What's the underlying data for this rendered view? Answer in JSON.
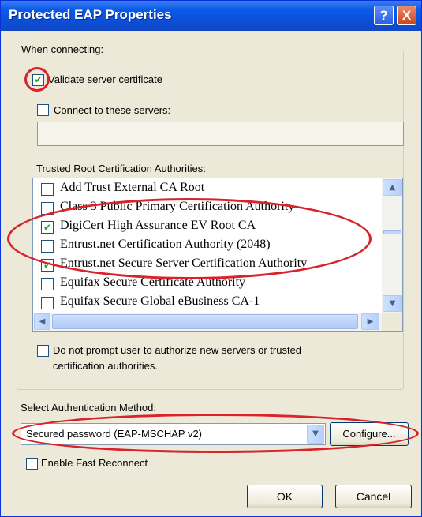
{
  "window": {
    "title": "Protected EAP Properties",
    "help_glyph": "?",
    "close_glyph": "X"
  },
  "when_connecting": {
    "label": "When connecting:",
    "validate_label": "Validate server certificate",
    "validate_checked": true,
    "connect_label": "Connect to these servers:",
    "connect_checked": false,
    "servers_value": ""
  },
  "trusted_root": {
    "label": "Trusted Root Certification Authorities:",
    "items": [
      {
        "label": "Add Trust External CA Root",
        "checked": false
      },
      {
        "label": "Class 3 Public Primary Certification Authority",
        "checked": false
      },
      {
        "label": "DigiCert High Assurance EV Root CA",
        "checked": true
      },
      {
        "label": "Entrust.net Certification Authority (2048)",
        "checked": false
      },
      {
        "label": "Entrust.net Secure Server Certification Authority",
        "checked": true
      },
      {
        "label": "Equifax Secure Certificate Authority",
        "checked": false
      },
      {
        "label": "Equifax Secure Global eBusiness CA-1",
        "checked": false
      }
    ]
  },
  "do_not_prompt": {
    "label_line1": "Do not prompt user to authorize new servers or trusted",
    "label_line2": "certification authorities.",
    "checked": false
  },
  "auth_method": {
    "label": "Select Authentication Method:",
    "selected": "Secured password (EAP-MSCHAP v2)",
    "configure_label": "Configure..."
  },
  "fast_reconnect": {
    "label": "Enable Fast Reconnect",
    "checked": false
  },
  "footer": {
    "ok_label": "OK",
    "cancel_label": "Cancel"
  },
  "colors": {
    "annotation": "#d9222a",
    "titlebar": "#0a5ae8",
    "dialog_bg": "#ece9d8"
  }
}
